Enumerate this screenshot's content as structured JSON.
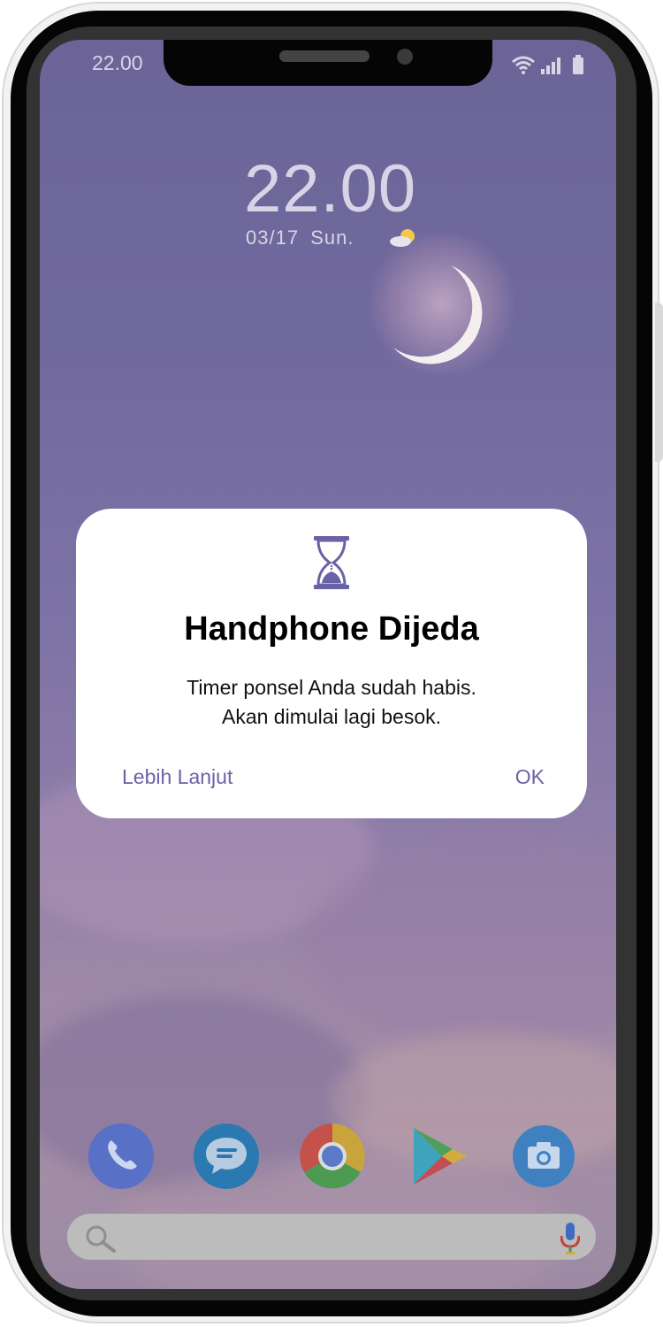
{
  "status_bar": {
    "time": "22.00",
    "wifi_icon": "wifi-icon",
    "signal_icon": "signal-icon",
    "battery_icon": "battery-icon"
  },
  "lock_clock": {
    "time": "22.00",
    "date": "03/17",
    "day": "Sun.",
    "weather_icon": "partly-cloudy-icon"
  },
  "dialog": {
    "icon": "hourglass-icon",
    "title": "Handphone Dijeda",
    "message_line1": "Timer ponsel Anda sudah habis.",
    "message_line2": "Akan dimulai lagi besok.",
    "more_button": "Lebih Lanjut",
    "ok_button": "OK"
  },
  "dock": {
    "apps": [
      "phone-icon",
      "messages-icon",
      "chrome-icon",
      "play-store-icon",
      "camera-icon"
    ]
  },
  "search": {
    "search_icon": "search-icon",
    "mic_icon": "mic-icon"
  },
  "colors": {
    "accent": "#6a62a6",
    "dialog_bg": "#ffffff",
    "wallpaper_top": "#6b6497",
    "wallpaper_bottom": "#a48ea6"
  }
}
